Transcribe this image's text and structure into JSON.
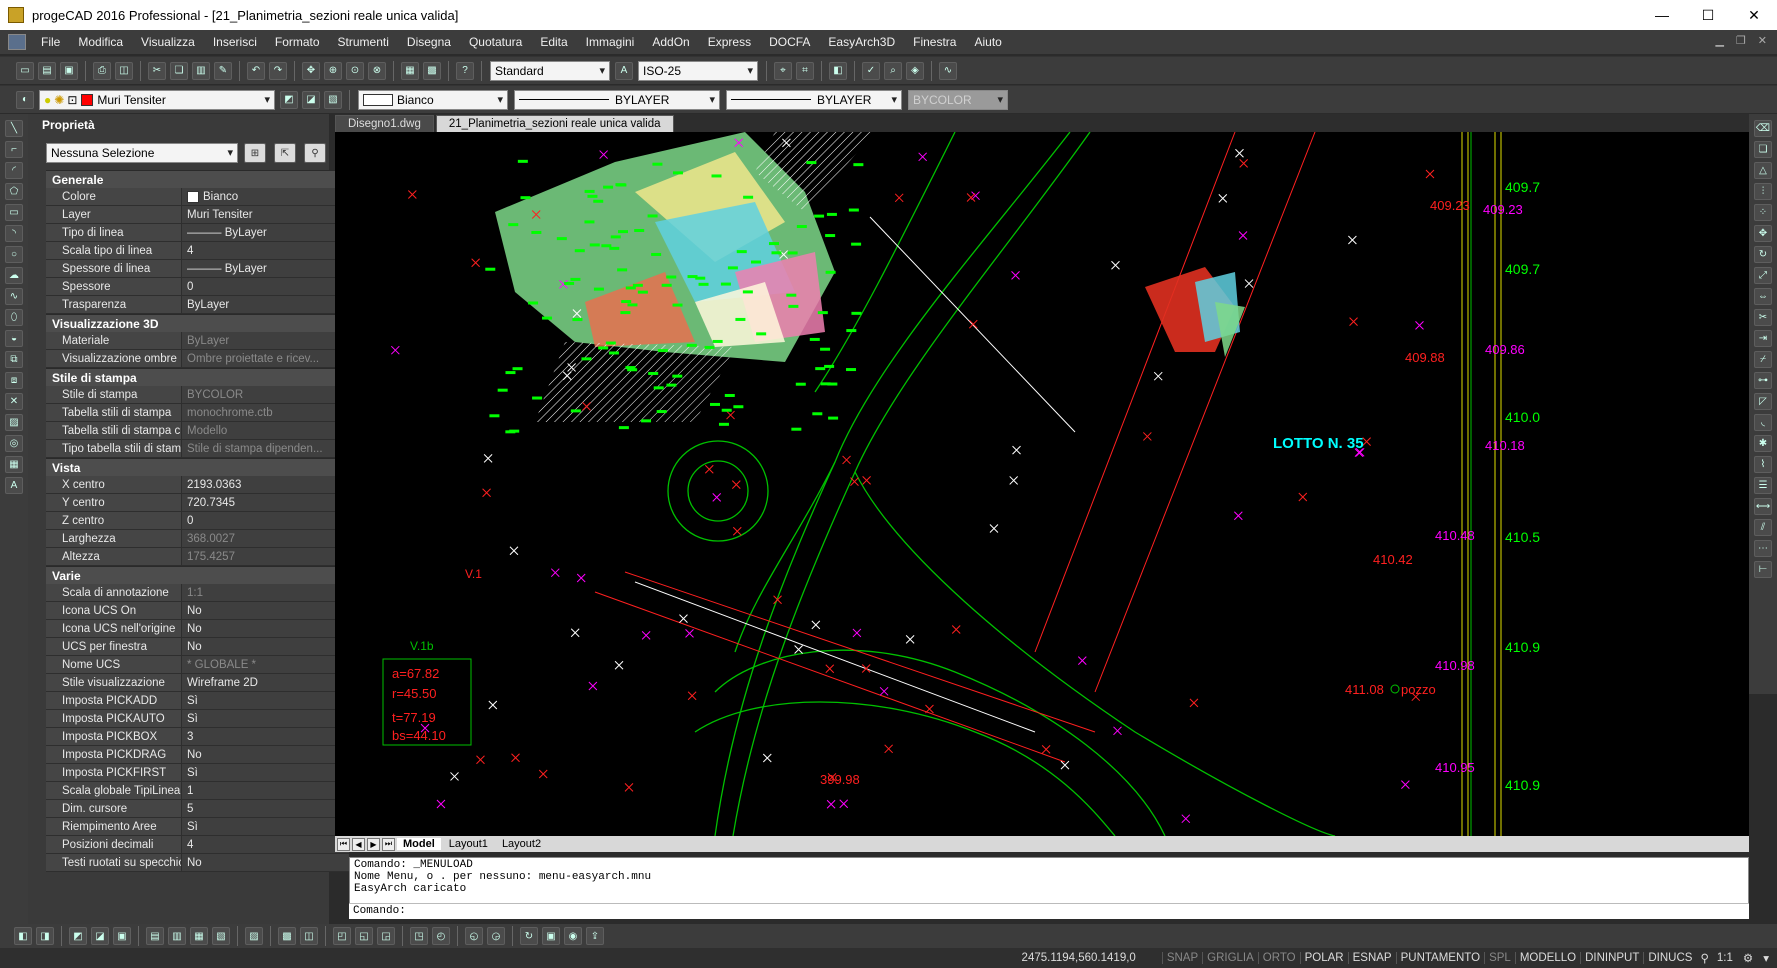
{
  "window": {
    "title": "progeCAD 2016 Professional - [21_Planimetria_sezioni reale unica valida]",
    "minimize": "—",
    "maximize": "☐",
    "close": "✕"
  },
  "menu": [
    "File",
    "Modifica",
    "Visualizza",
    "Inserisci",
    "Formato",
    "Strumenti",
    "Disegna",
    "Quotatura",
    "Edita",
    "Immagini",
    "AddOn",
    "Express",
    "DOCFA",
    "EasyArch3D",
    "Finestra",
    "Aiuto"
  ],
  "toolbar": {
    "text_style": "Standard",
    "dim_style": "ISO-25",
    "layer": "Muri Tensiter",
    "color": "Bianco",
    "linetype": "BYLAYER",
    "lineweight": "BYLAYER",
    "plotstyle": "BYCOLOR",
    "colors": {
      "layer_swatch": "#ff0000"
    }
  },
  "properties": {
    "title": "Proprietà",
    "selection": "Nessuna Selezione",
    "sections": [
      {
        "name": "Generale",
        "rows": [
          {
            "k": "Colore",
            "v": "Bianco"
          },
          {
            "k": "Layer",
            "v": "Muri Tensiter"
          },
          {
            "k": "Tipo di linea",
            "v": "——— ByLayer"
          },
          {
            "k": "Scala tipo di linea",
            "v": "4"
          },
          {
            "k": "Spessore di linea",
            "v": "——— ByLayer"
          },
          {
            "k": "Spessore",
            "v": "0"
          },
          {
            "k": "Trasparenza",
            "v": "ByLayer"
          }
        ]
      },
      {
        "name": "Visualizzazione 3D",
        "rows": [
          {
            "k": "Materiale",
            "v": "ByLayer",
            "ro": true
          },
          {
            "k": "Visualizzazione ombre",
            "v": "Ombre proiettate e ricev...",
            "ro": true
          }
        ]
      },
      {
        "name": "Stile di stampa",
        "rows": [
          {
            "k": "Stile di stampa",
            "v": "BYCOLOR",
            "ro": true
          },
          {
            "k": "Tabella stili di stampa",
            "v": "monochrome.ctb",
            "ro": true
          },
          {
            "k": "Tabella stili di stampa c...",
            "v": "Modello",
            "ro": true
          },
          {
            "k": "Tipo tabella stili di stampa",
            "v": "Stile di stampa dipenden...",
            "ro": true
          }
        ]
      },
      {
        "name": "Vista",
        "rows": [
          {
            "k": "X centro",
            "v": "2193.0363"
          },
          {
            "k": "Y centro",
            "v": "720.7345"
          },
          {
            "k": "Z centro",
            "v": "0"
          },
          {
            "k": "Larghezza",
            "v": "368.0027",
            "ro": true
          },
          {
            "k": "Altezza",
            "v": "175.4257",
            "ro": true
          }
        ]
      },
      {
        "name": "Varie",
        "rows": [
          {
            "k": "Scala di annotazione",
            "v": "1:1",
            "ro": true
          },
          {
            "k": "Icona UCS On",
            "v": "No"
          },
          {
            "k": "Icona UCS nell'origine",
            "v": "No"
          },
          {
            "k": "UCS per finestra",
            "v": "No"
          },
          {
            "k": "Nome UCS",
            "v": "* GLOBALE *",
            "ro": true
          },
          {
            "k": "Stile visualizzazione",
            "v": "Wireframe 2D"
          },
          {
            "k": "Imposta PICKADD",
            "v": "Sì"
          },
          {
            "k": "Imposta PICKAUTO",
            "v": "Sì"
          },
          {
            "k": "Imposta PICKBOX",
            "v": "3"
          },
          {
            "k": "Imposta PICKDRAG",
            "v": "No"
          },
          {
            "k": "Imposta PICKFIRST",
            "v": "Sì"
          },
          {
            "k": "Scala globale TipiLinea",
            "v": "1"
          },
          {
            "k": "Dim. cursore",
            "v": "5"
          },
          {
            "k": "Riempimento Aree",
            "v": "Sì"
          },
          {
            "k": "Posizioni decimali",
            "v": "4"
          },
          {
            "k": "Testi ruotati su specchio",
            "v": "No"
          }
        ]
      }
    ]
  },
  "doc_tabs": [
    "Disegno1.dwg",
    "21_Planimetria_sezioni reale unica valida"
  ],
  "drawing": {
    "labels": {
      "lotto": "LOTTO N. 35",
      "v1": "V.1",
      "v1b": "V.1b",
      "a": "a=67.82",
      "r": "r=45.50",
      "t": "t=77.19",
      "bs": "bs=44.10",
      "e1": "409.23",
      "e2": "409.23",
      "e3": "409.7",
      "e4": "409.88",
      "e5": "409.86",
      "e6": "410.0",
      "e7": "410.18",
      "e8": "410.5",
      "e9": "410.48",
      "e10": "410.42",
      "e11": "410.9",
      "e12": "410.98",
      "e13": "411.08",
      "pozzo": "pozzo",
      "e14": "410.95",
      "e15": "410.9",
      "e16": "399.98"
    },
    "colors": {
      "background": "#000000",
      "roads": "#00c000",
      "points": "#ff0000",
      "elev_magenta": "#ff00ff",
      "lotto": "#00ffff"
    }
  },
  "layout_tabs": [
    "Model",
    "Layout1",
    "Layout2"
  ],
  "command": {
    "lines": [
      "Comando: _MENULOAD",
      "Nome Menu, o . per nessuno: menu-easyarch.mnu",
      "EasyArch caricato"
    ],
    "prompt": "Comando:"
  },
  "status": {
    "coords": "2475.1194,560.1419,0",
    "buttons": [
      {
        "label": "SNAP",
        "on": false
      },
      {
        "label": "GRIGLIA",
        "on": false
      },
      {
        "label": "ORTO",
        "on": false
      },
      {
        "label": "POLAR",
        "on": true
      },
      {
        "label": "ESNAP",
        "on": true
      },
      {
        "label": "PUNTAMENTO",
        "on": true
      },
      {
        "label": "SPL",
        "on": false
      },
      {
        "label": "MODELLO",
        "on": true
      },
      {
        "label": "DININPUT",
        "on": true
      },
      {
        "label": "DINUCS",
        "on": true
      }
    ],
    "scale": "1:1"
  }
}
